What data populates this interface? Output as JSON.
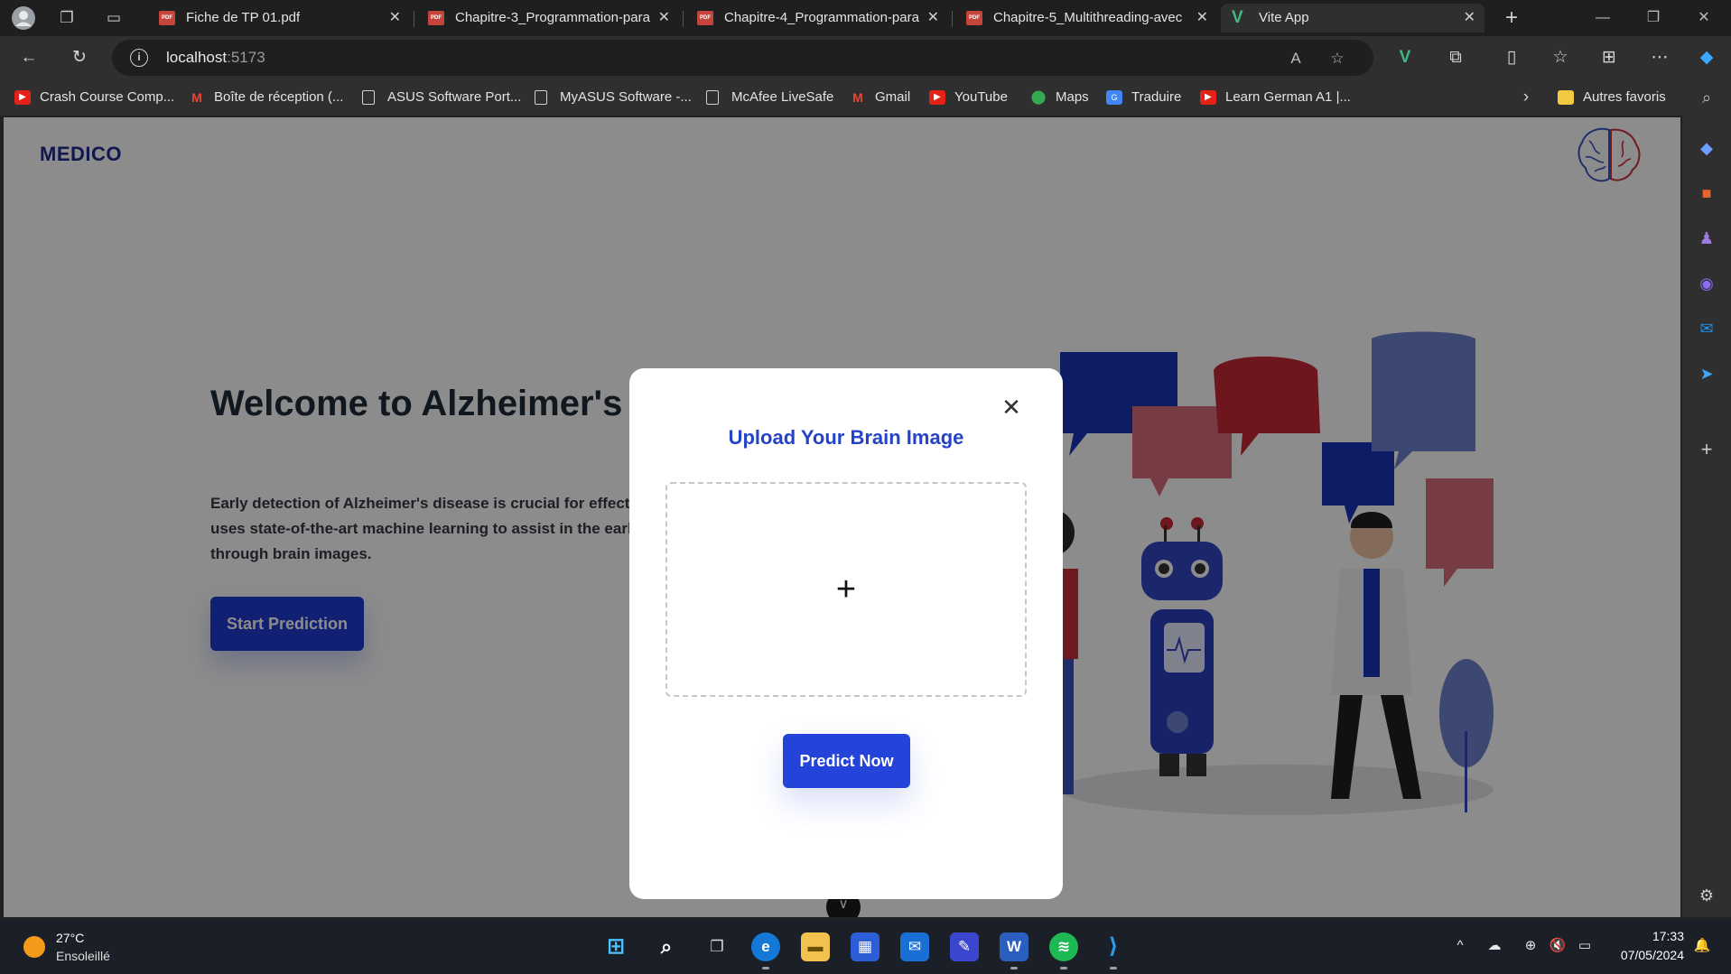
{
  "browser": {
    "tabs": [
      {
        "title": "Fiche de TP 01.pdf",
        "icon": "pdf-icon"
      },
      {
        "title": "Chapitre-3_Programmation-para",
        "icon": "pdf-icon"
      },
      {
        "title": "Chapitre-4_Programmation-para",
        "icon": "pdf-icon"
      },
      {
        "title": "Chapitre-5_Multithreading-avec",
        "icon": "pdf-icon"
      },
      {
        "title": "Vite App",
        "icon": "vue-icon",
        "active": true
      }
    ],
    "address": {
      "host": "localhost",
      "port": ":5173"
    },
    "bookmarks": [
      {
        "label": "Crash Course Comp...",
        "icon": "youtube-icon"
      },
      {
        "label": "Boîte de réception (...",
        "icon": "gmail-icon"
      },
      {
        "label": "ASUS Software Port...",
        "icon": "page-icon"
      },
      {
        "label": "MyASUS Software -...",
        "icon": "page-icon"
      },
      {
        "label": "McAfee LiveSafe",
        "icon": "page-icon"
      },
      {
        "label": "Gmail",
        "icon": "gmail-icon"
      },
      {
        "label": "YouTube",
        "icon": "youtube-icon"
      },
      {
        "label": "Maps",
        "icon": "maps-icon"
      },
      {
        "label": "Traduire",
        "icon": "translate-icon"
      },
      {
        "label": "Learn German A1 |...",
        "icon": "youtube-icon"
      }
    ],
    "other_favorites": "Autres favoris"
  },
  "page": {
    "brand": "MEDICO",
    "hero_title": "Welcome to Alzheimer's Disease Detection",
    "hero_description": "Early detection of Alzheimer's disease is crucial for effective treatment. Our innovative platform uses state-of-the-art machine learning to assist in the early diagnosis of Alzheimer's disease through brain images.",
    "start_button": "Start Prediction",
    "scroll_icon": "chevron-down-icon"
  },
  "modal": {
    "title": "Upload Your Brain Image",
    "upload_symbol": "+",
    "predict_button": "Predict Now",
    "close_symbol": "✕"
  },
  "taskbar": {
    "weather": {
      "temp": "27°C",
      "condition": "Ensoleillé"
    },
    "time": "17:33",
    "date": "07/05/2024"
  },
  "colors": {
    "primary": "#2443d8",
    "brand": "#1e2c8c",
    "overlay": "rgba(0,0,0,0.45)"
  }
}
